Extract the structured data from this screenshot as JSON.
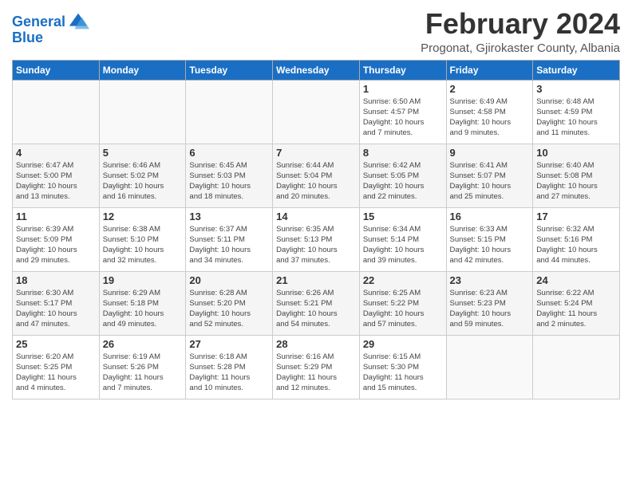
{
  "header": {
    "logo_line1": "General",
    "logo_line2": "Blue",
    "month_title": "February 2024",
    "subtitle": "Progonat, Gjirokaster County, Albania"
  },
  "days_of_week": [
    "Sunday",
    "Monday",
    "Tuesday",
    "Wednesday",
    "Thursday",
    "Friday",
    "Saturday"
  ],
  "weeks": [
    [
      {
        "day": "",
        "info": ""
      },
      {
        "day": "",
        "info": ""
      },
      {
        "day": "",
        "info": ""
      },
      {
        "day": "",
        "info": ""
      },
      {
        "day": "1",
        "info": "Sunrise: 6:50 AM\nSunset: 4:57 PM\nDaylight: 10 hours\nand 7 minutes."
      },
      {
        "day": "2",
        "info": "Sunrise: 6:49 AM\nSunset: 4:58 PM\nDaylight: 10 hours\nand 9 minutes."
      },
      {
        "day": "3",
        "info": "Sunrise: 6:48 AM\nSunset: 4:59 PM\nDaylight: 10 hours\nand 11 minutes."
      }
    ],
    [
      {
        "day": "4",
        "info": "Sunrise: 6:47 AM\nSunset: 5:00 PM\nDaylight: 10 hours\nand 13 minutes."
      },
      {
        "day": "5",
        "info": "Sunrise: 6:46 AM\nSunset: 5:02 PM\nDaylight: 10 hours\nand 16 minutes."
      },
      {
        "day": "6",
        "info": "Sunrise: 6:45 AM\nSunset: 5:03 PM\nDaylight: 10 hours\nand 18 minutes."
      },
      {
        "day": "7",
        "info": "Sunrise: 6:44 AM\nSunset: 5:04 PM\nDaylight: 10 hours\nand 20 minutes."
      },
      {
        "day": "8",
        "info": "Sunrise: 6:42 AM\nSunset: 5:05 PM\nDaylight: 10 hours\nand 22 minutes."
      },
      {
        "day": "9",
        "info": "Sunrise: 6:41 AM\nSunset: 5:07 PM\nDaylight: 10 hours\nand 25 minutes."
      },
      {
        "day": "10",
        "info": "Sunrise: 6:40 AM\nSunset: 5:08 PM\nDaylight: 10 hours\nand 27 minutes."
      }
    ],
    [
      {
        "day": "11",
        "info": "Sunrise: 6:39 AM\nSunset: 5:09 PM\nDaylight: 10 hours\nand 29 minutes."
      },
      {
        "day": "12",
        "info": "Sunrise: 6:38 AM\nSunset: 5:10 PM\nDaylight: 10 hours\nand 32 minutes."
      },
      {
        "day": "13",
        "info": "Sunrise: 6:37 AM\nSunset: 5:11 PM\nDaylight: 10 hours\nand 34 minutes."
      },
      {
        "day": "14",
        "info": "Sunrise: 6:35 AM\nSunset: 5:13 PM\nDaylight: 10 hours\nand 37 minutes."
      },
      {
        "day": "15",
        "info": "Sunrise: 6:34 AM\nSunset: 5:14 PM\nDaylight: 10 hours\nand 39 minutes."
      },
      {
        "day": "16",
        "info": "Sunrise: 6:33 AM\nSunset: 5:15 PM\nDaylight: 10 hours\nand 42 minutes."
      },
      {
        "day": "17",
        "info": "Sunrise: 6:32 AM\nSunset: 5:16 PM\nDaylight: 10 hours\nand 44 minutes."
      }
    ],
    [
      {
        "day": "18",
        "info": "Sunrise: 6:30 AM\nSunset: 5:17 PM\nDaylight: 10 hours\nand 47 minutes."
      },
      {
        "day": "19",
        "info": "Sunrise: 6:29 AM\nSunset: 5:18 PM\nDaylight: 10 hours\nand 49 minutes."
      },
      {
        "day": "20",
        "info": "Sunrise: 6:28 AM\nSunset: 5:20 PM\nDaylight: 10 hours\nand 52 minutes."
      },
      {
        "day": "21",
        "info": "Sunrise: 6:26 AM\nSunset: 5:21 PM\nDaylight: 10 hours\nand 54 minutes."
      },
      {
        "day": "22",
        "info": "Sunrise: 6:25 AM\nSunset: 5:22 PM\nDaylight: 10 hours\nand 57 minutes."
      },
      {
        "day": "23",
        "info": "Sunrise: 6:23 AM\nSunset: 5:23 PM\nDaylight: 10 hours\nand 59 minutes."
      },
      {
        "day": "24",
        "info": "Sunrise: 6:22 AM\nSunset: 5:24 PM\nDaylight: 11 hours\nand 2 minutes."
      }
    ],
    [
      {
        "day": "25",
        "info": "Sunrise: 6:20 AM\nSunset: 5:25 PM\nDaylight: 11 hours\nand 4 minutes."
      },
      {
        "day": "26",
        "info": "Sunrise: 6:19 AM\nSunset: 5:26 PM\nDaylight: 11 hours\nand 7 minutes."
      },
      {
        "day": "27",
        "info": "Sunrise: 6:18 AM\nSunset: 5:28 PM\nDaylight: 11 hours\nand 10 minutes."
      },
      {
        "day": "28",
        "info": "Sunrise: 6:16 AM\nSunset: 5:29 PM\nDaylight: 11 hours\nand 12 minutes."
      },
      {
        "day": "29",
        "info": "Sunrise: 6:15 AM\nSunset: 5:30 PM\nDaylight: 11 hours\nand 15 minutes."
      },
      {
        "day": "",
        "info": ""
      },
      {
        "day": "",
        "info": ""
      }
    ]
  ]
}
